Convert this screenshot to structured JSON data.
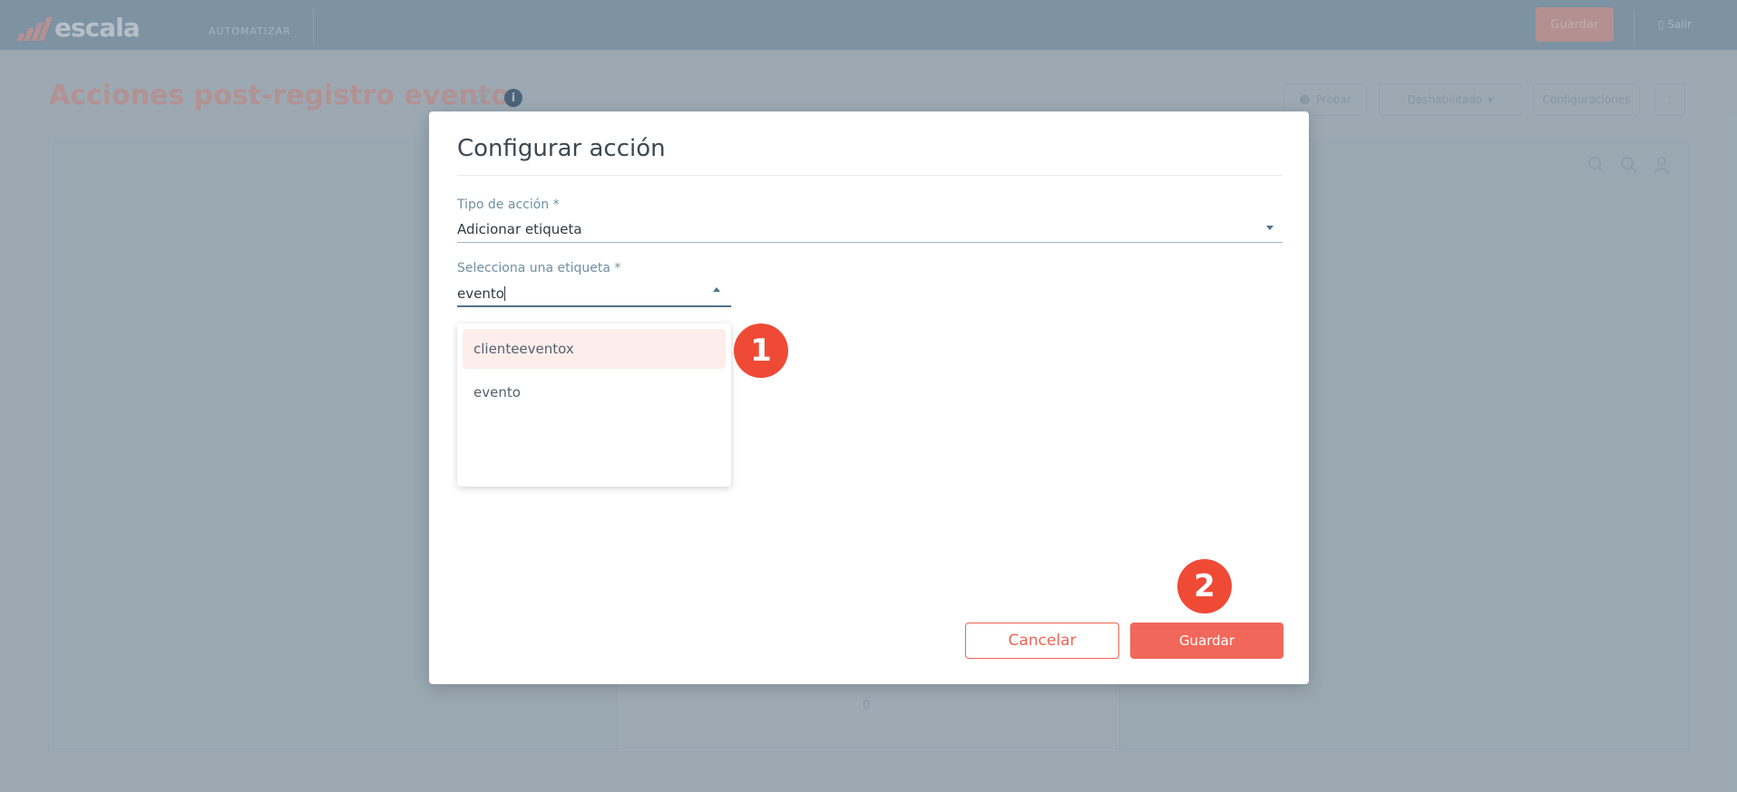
{
  "app": {
    "brand": "escala",
    "nav_tab": "AUTOMATIZAR",
    "top_save_label": "Guardar",
    "exit_label": "Salir"
  },
  "page": {
    "title": "Acciones post-registro evento",
    "buttons": {
      "test_label": "Probar",
      "status_label": "Deshabilitado",
      "config_label": "Configuraciones"
    },
    "canvas_counter": "0"
  },
  "modal": {
    "title": "Configurar acción",
    "action_type": {
      "label": "Tipo de acción *",
      "value": "Adicionar etiqueta"
    },
    "tag_select": {
      "label": "Selecciona una etiqueta *",
      "value": "evento",
      "options": [
        "clienteeventox",
        "evento"
      ],
      "highlighted_option": "clienteeventox"
    },
    "cancel_label": "Cancelar",
    "save_label": "Guardar"
  },
  "annotations": {
    "step_1": "1",
    "step_2": "2",
    "color": "#ef4a36"
  },
  "colors": {
    "accent": "#f1685a",
    "topbar": "#3a5468",
    "label": "#6f8fa3"
  }
}
